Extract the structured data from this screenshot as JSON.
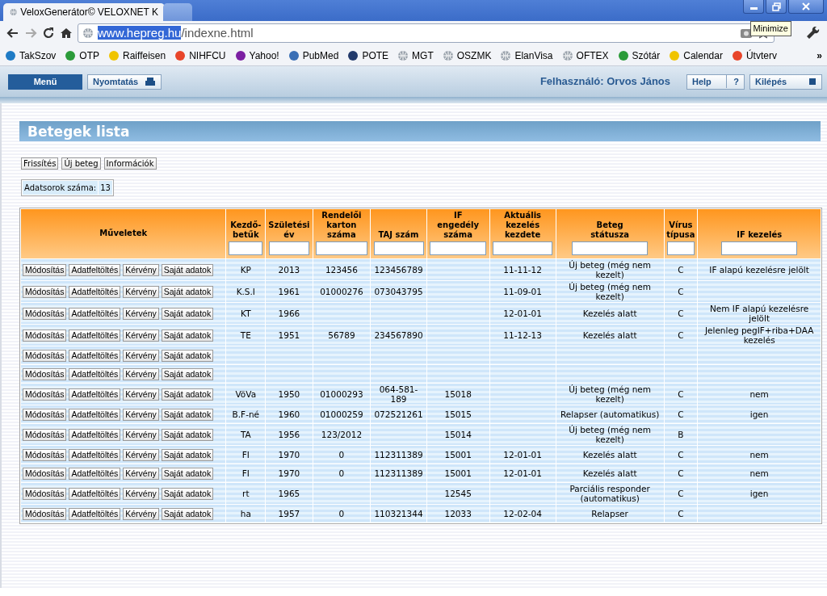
{
  "browser": {
    "tabs": [
      {
        "title": "VeloxGenerátor© VELOXNET K",
        "selected": true
      },
      {
        "selected": false
      }
    ],
    "tooltip": "Minimize",
    "address": {
      "highlighted": "www.hepreg.hu",
      "rest": "/indexne.html"
    },
    "bookmarks": [
      {
        "label": "TakSzov",
        "kind": "logo"
      },
      {
        "label": "OTP",
        "kind": "logo"
      },
      {
        "label": "Raiffeisen",
        "kind": "logo"
      },
      {
        "label": "NIHFCU",
        "kind": "logo"
      },
      {
        "label": "Yahoo!",
        "kind": "logo"
      },
      {
        "label": "PubMed",
        "kind": "logo"
      },
      {
        "label": "POTE",
        "kind": "logo"
      },
      {
        "label": "MGT",
        "kind": "globe"
      },
      {
        "label": "OSZMK",
        "kind": "globe"
      },
      {
        "label": "ElanVisa",
        "kind": "globe"
      },
      {
        "label": "OFTEX",
        "kind": "globe"
      },
      {
        "label": "Szótár",
        "kind": "logo"
      },
      {
        "label": "Calendar",
        "kind": "logo"
      },
      {
        "label": "Útvterv",
        "kind": "logo"
      }
    ],
    "more": "»"
  },
  "app_header": {
    "menu": "Menü",
    "print": "Nyomtatás",
    "user": "Felhasználó: Orvos János",
    "help": "Help",
    "help_key": "?",
    "logout": "Kilépés"
  },
  "page": {
    "title": "Betegek lista",
    "buttons": [
      "Frissítés",
      "Új beteg",
      "Információk"
    ],
    "count_label": "Adatsorok száma:",
    "count": "13",
    "table": {
      "actions_column": "Műveletek",
      "columns": [
        "Kezdő-betűk",
        "Születési év",
        "Rendelői karton száma",
        "TAJ szám",
        "IF engedély száma",
        "Aktuális kezelés kezdete",
        "Beteg státusza",
        "Vírus típusa",
        "IF kezelés"
      ],
      "rows": [
        {
          "actions": [
            "Módosítás",
            "Adatfeltöltés",
            "Kérvény",
            "Saját adatok"
          ],
          "cells": [
            "KP",
            "2013",
            "123456",
            "123456789",
            null,
            "11-11-12",
            "Új beteg (még nem kezelt)",
            "C",
            "IF alapú kezelésre jelölt"
          ]
        },
        {
          "actions": [
            "Módosítás",
            "Adatfeltöltés",
            "Kérvény",
            "Saját adatok"
          ],
          "cells": [
            "K.S.I",
            "1961",
            "01000276",
            "073043795",
            null,
            "11-09-01",
            "Új beteg (még nem kezelt)",
            "C",
            null
          ]
        },
        {
          "actions": [
            "Módosítás",
            "Adatfeltöltés",
            "Kérvény",
            "Saját adatok"
          ],
          "cells": [
            "KT",
            "1966",
            null,
            null,
            null,
            "12-01-01",
            "Kezelés alatt",
            "C",
            "Nem IF alapú kezelésre jelölt"
          ]
        },
        {
          "actions": [
            "Módosítás",
            "Adatfeltöltés",
            "Kérvény",
            "Saját adatok"
          ],
          "cells": [
            "TE",
            "1951",
            "56789",
            "234567890",
            null,
            "11-12-13",
            "Kezelés alatt",
            "C",
            "Jelenleg pegIF+riba+DAA kezelés"
          ]
        },
        {
          "actions": [
            "Módosítás",
            "Adatfeltöltés",
            "Kérvény",
            "Saját adatok"
          ],
          "cells": [
            null,
            null,
            null,
            null,
            null,
            null,
            null,
            null,
            null
          ]
        },
        {
          "actions": [
            "Módosítás",
            "Adatfeltöltés",
            "Kérvény",
            "Saját adatok"
          ],
          "cells": [
            null,
            null,
            null,
            null,
            null,
            null,
            null,
            null,
            null
          ]
        },
        {
          "actions": [
            "Módosítás",
            "Adatfeltöltés",
            "Kérvény",
            "Saját adatok"
          ],
          "cells": [
            "VöVa",
            "1950",
            "01000293",
            "064-581-189",
            "15018",
            null,
            "Új beteg (még nem kezelt)",
            "C",
            "nem"
          ]
        },
        {
          "actions": [
            "Módosítás",
            "Adatfeltöltés",
            "Kérvény",
            "Saját adatok"
          ],
          "cells": [
            "B.F-né",
            "1960",
            "01000259",
            "072521261",
            "15015",
            null,
            "Relapser (automatikus)",
            "C",
            "igen"
          ]
        },
        {
          "actions": [
            "Módosítás",
            "Adatfeltöltés",
            "Kérvény",
            "Saját adatok"
          ],
          "cells": [
            "TA",
            "1956",
            "123/2012",
            null,
            "15014",
            null,
            "Új beteg (még nem kezelt)",
            "B",
            null
          ]
        },
        {
          "actions": [
            "Módosítás",
            "Adatfeltöltés",
            "Kérvény",
            "Saját adatok"
          ],
          "cells": [
            "FI",
            "1970",
            "0",
            "112311389",
            "15001",
            "12-01-01",
            "Kezelés alatt",
            "C",
            "nem"
          ]
        },
        {
          "actions": [
            "Módosítás",
            "Adatfeltöltés",
            "Kérvény",
            "Saját adatok"
          ],
          "cells": [
            "FI",
            "1970",
            "0",
            "112311389",
            "15001",
            "12-01-01",
            "Kezelés alatt",
            "C",
            "nem"
          ]
        },
        {
          "actions": [
            "Módosítás",
            "Adatfeltöltés",
            "Kérvény",
            "Saját adatok"
          ],
          "cells": [
            "rt",
            "1965",
            null,
            null,
            "12545",
            null,
            "Parciális responder (automatikus)",
            "C",
            "igen"
          ]
        },
        {
          "actions": [
            "Módosítás",
            "Adatfeltöltés",
            "Kérvény",
            "Saját adatok"
          ],
          "cells": [
            "ha",
            "1957",
            "0",
            "110321344",
            "12033",
            "12-02-04",
            "Relapser",
            "C",
            null
          ]
        }
      ]
    }
  }
}
